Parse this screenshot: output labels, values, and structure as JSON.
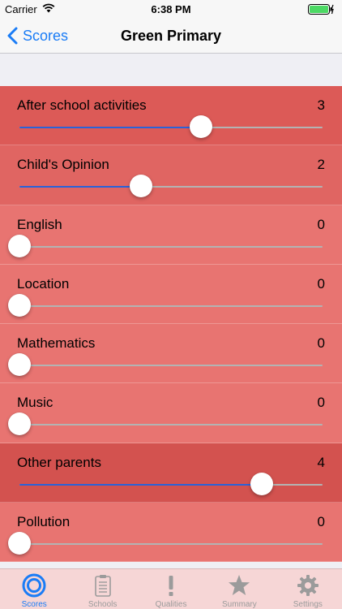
{
  "status": {
    "carrier": "Carrier",
    "time": "6:38 PM"
  },
  "nav": {
    "back_label": "Scores",
    "title": "Green Primary"
  },
  "scores": [
    {
      "label": "After school activities",
      "value": "3",
      "level": 0.6,
      "color": "#dc5a57"
    },
    {
      "label": "Child's Opinion",
      "value": "2",
      "level": 0.4,
      "color": "#e06562"
    },
    {
      "label": "English",
      "value": "0",
      "level": 0,
      "color": "#e87471"
    },
    {
      "label": "Location",
      "value": "0",
      "level": 0,
      "color": "#e87471"
    },
    {
      "label": "Mathematics",
      "value": "0",
      "level": 0,
      "color": "#e87471"
    },
    {
      "label": "Music",
      "value": "0",
      "level": 0,
      "color": "#e87471"
    },
    {
      "label": "Other parents",
      "value": "4",
      "level": 0.8,
      "color": "#d3524f"
    },
    {
      "label": "Pollution",
      "value": "0",
      "level": 0,
      "color": "#e87471"
    }
  ],
  "tabs": [
    {
      "label": "Scores",
      "icon": "target-icon",
      "active": true
    },
    {
      "label": "Schools",
      "icon": "clipboard-icon",
      "active": false
    },
    {
      "label": "Qualities",
      "icon": "exclamation-icon",
      "active": false
    },
    {
      "label": "Summary",
      "icon": "star-icon",
      "active": false
    },
    {
      "label": "Settings",
      "icon": "gear-icon",
      "active": false
    }
  ],
  "colors": {
    "accent": "#1a7cf6",
    "slider_fill": "#2a62d8",
    "tab_bar": "#f6d6d6"
  }
}
